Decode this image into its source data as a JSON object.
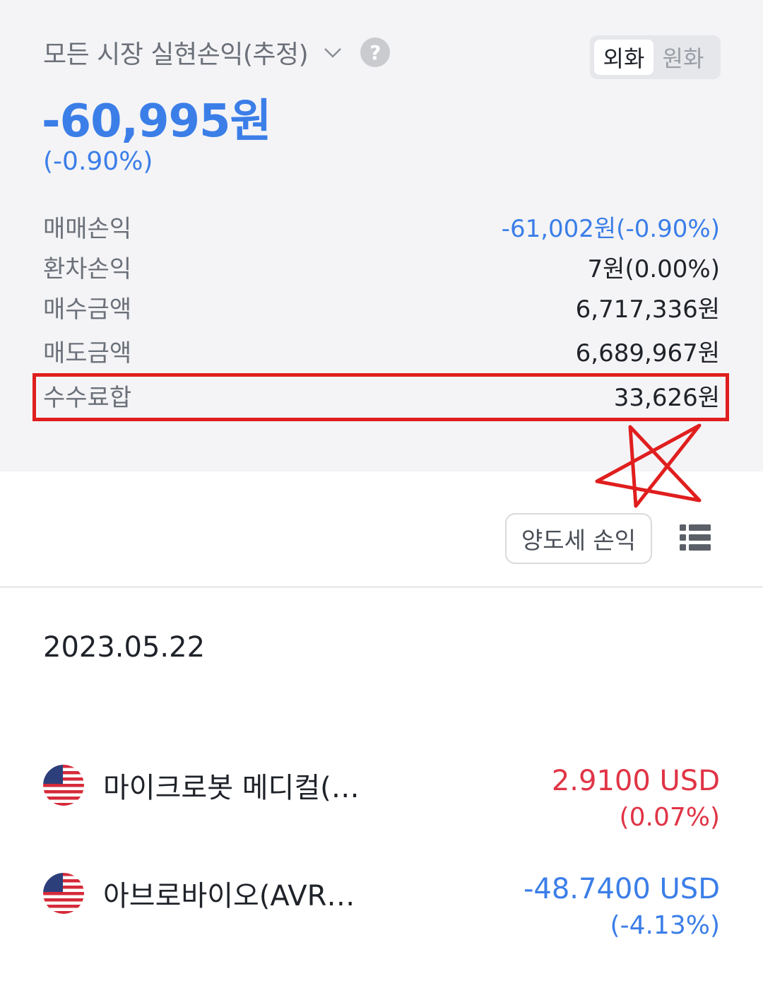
{
  "header": {
    "title": "모든 시장 실현손익(추정)",
    "toggle": {
      "options": [
        "외화",
        "원화"
      ],
      "selected": "외화"
    },
    "help_label": "?"
  },
  "summary": {
    "total": "-60,995원",
    "total_pct": "(-0.90%)",
    "rows": [
      {
        "label": "매매손익",
        "value": "-61,002원(-0.90%)"
      },
      {
        "label": "환차손익",
        "value": "7원(0.00%)"
      },
      {
        "label": "매수금액",
        "value": "6,717,336원"
      },
      {
        "label": "매도금액",
        "value": "6,689,967원"
      },
      {
        "label": "수수료합",
        "value": "33,626원"
      }
    ]
  },
  "actions": {
    "tax_button": "양도세 손익"
  },
  "history": {
    "date": "2023.05.22",
    "items": [
      {
        "name": "마이크로봇 메디컬(…",
        "amount": "2.9100 USD",
        "pct": "(0.07%)"
      },
      {
        "name": "아브로바이오(AVR…",
        "amount": "-48.7400 USD",
        "pct": "(-4.13%)"
      }
    ]
  },
  "colors": {
    "accent_blue": "#3b7ee8",
    "loss_red": "#e03446",
    "annotation_red": "#e01e1e"
  },
  "icons": [
    "chevron-down-icon",
    "help-icon",
    "list-icon",
    "us-flag-icon",
    "star-annotation"
  ]
}
